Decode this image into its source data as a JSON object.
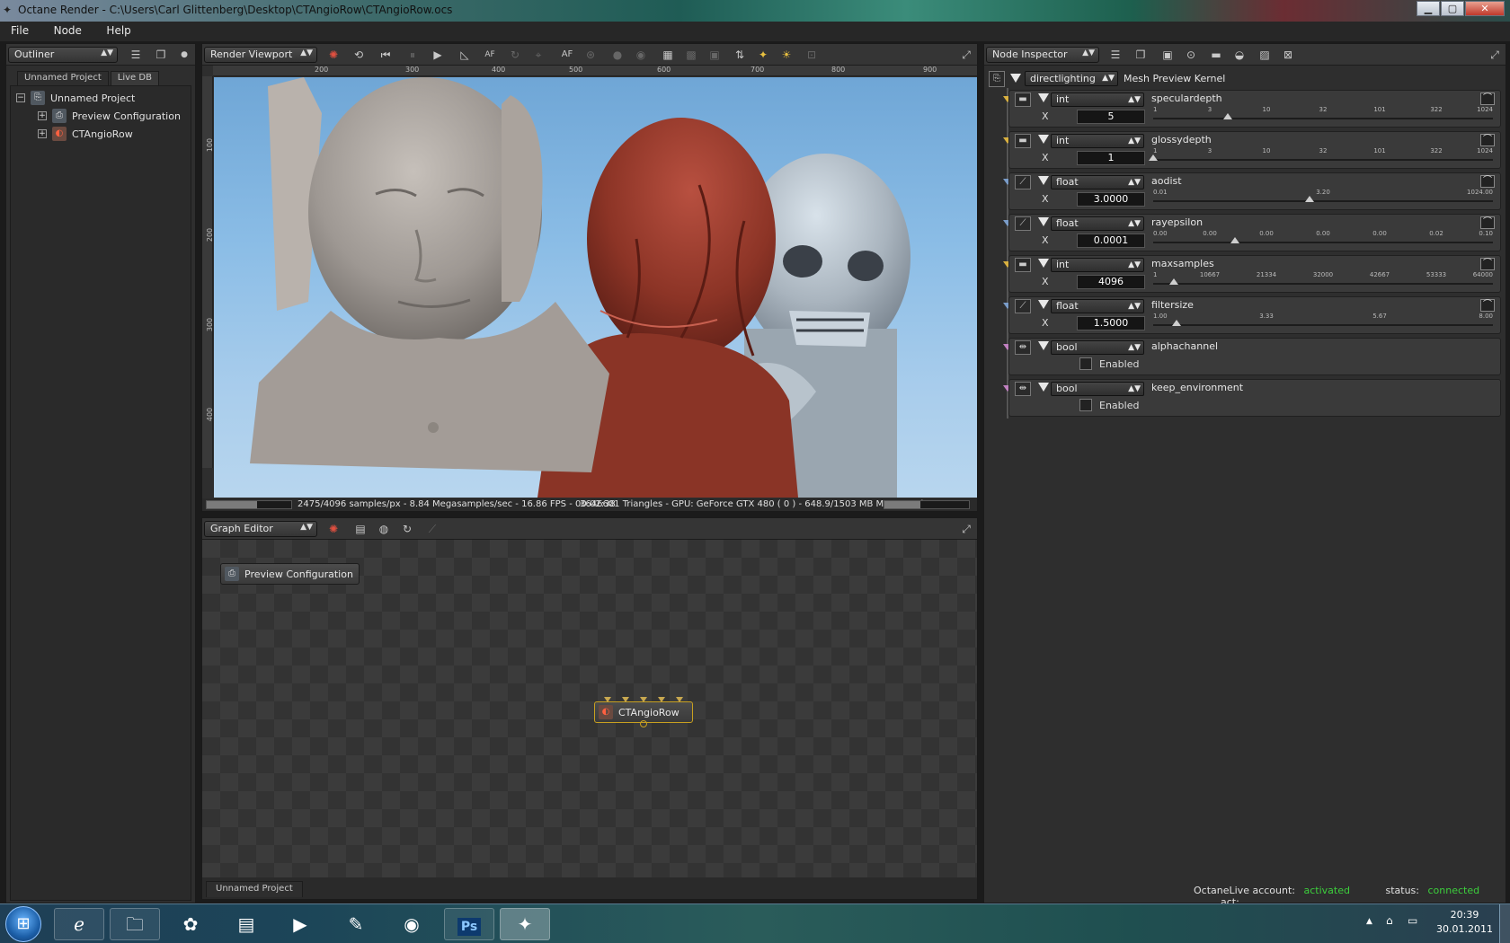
{
  "window": {
    "title": "Octane Render - C:\\Users\\Carl Glittenberg\\Desktop\\CTAngioRow\\CTAngioRow.ocs",
    "buttons": [
      "minimize",
      "maximize",
      "close"
    ]
  },
  "menubar": {
    "items": [
      "File",
      "Node",
      "Help"
    ]
  },
  "outliner": {
    "combo": "Outliner",
    "tabs": [
      "Unnamed Project",
      "Live DB"
    ],
    "tree": [
      {
        "label": "Unnamed Project",
        "expander": "−"
      },
      {
        "label": "Preview Configuration",
        "expander": "+"
      },
      {
        "label": "CTAngioRow",
        "expander": "+"
      }
    ]
  },
  "viewport": {
    "combo": "Render Viewport",
    "ruler_h": [
      "200",
      "300",
      "400",
      "500",
      "600",
      "700",
      "800",
      "900"
    ],
    "ruler_v": [
      "100",
      "200",
      "300",
      "400"
    ],
    "status_left": "2475/4096 samples/px - 8.84 Megasamples/sec - 16.86 FPS - 00:02:38",
    "status_right": "3646601 Triangles - GPU: GeForce GTX 480 ( 0 ) - 648.9/1503 MB Mem Used",
    "progress_fraction": 0.6,
    "mem_fraction": 0.43
  },
  "graph_editor": {
    "combo": "Graph Editor",
    "nodes": [
      "Preview Configuration",
      "CTAngioRow"
    ],
    "tab": "Unnamed Project"
  },
  "inspector": {
    "combo": "Node Inspector",
    "kernel_combo": "directlighting",
    "kernel_label": "Mesh Preview Kernel",
    "params": [
      {
        "type": "int",
        "name": "speculardepth",
        "value": "5",
        "ticks": [
          "1",
          "3",
          "10",
          "32",
          "101",
          "322",
          "1024"
        ],
        "fraction": 0.22
      },
      {
        "type": "int",
        "name": "glossydepth",
        "value": "1",
        "ticks": [
          "1",
          "3",
          "10",
          "32",
          "101",
          "322",
          "1024"
        ],
        "fraction": 0.0
      },
      {
        "type": "float",
        "name": "aodist",
        "value": "3.0000",
        "ticks": [
          "0.01",
          "3.20",
          "1024.00"
        ],
        "fraction": 0.46
      },
      {
        "type": "float",
        "name": "rayepsilon",
        "value": "0.0001",
        "ticks": [
          "0.00",
          "0.00",
          "0.00",
          "0.00",
          "0.00",
          "0.02",
          "0.10"
        ],
        "fraction": 0.24
      },
      {
        "type": "int",
        "name": "maxsamples",
        "value": "4096",
        "ticks": [
          "1",
          "10667",
          "21334",
          "32000",
          "42667",
          "53333",
          "64000"
        ],
        "fraction": 0.06
      },
      {
        "type": "float",
        "name": "filtersize",
        "value": "1.5000",
        "ticks": [
          "1.00",
          "3.33",
          "5.67",
          "8.00"
        ],
        "fraction": 0.07
      },
      {
        "type": "bool",
        "name": "alphachannel",
        "check_label": "Enabled"
      },
      {
        "type": "bool",
        "name": "keep_environment",
        "check_label": "Enabled"
      }
    ],
    "x_label": "X"
  },
  "live_status": {
    "account_label": "OctaneLive account:",
    "account_value": "activated",
    "status_label": "status:",
    "status_value": "connected",
    "act_label": "act:"
  },
  "taskbar": {
    "apps": [
      "internet-explorer",
      "file-explorer",
      "picasa",
      "notepad",
      "media-player",
      "app",
      "browser",
      "photoshop",
      "octane"
    ],
    "time": "20:39",
    "date": "30.01.2011"
  },
  "colors": {
    "status_green": "#3ccf3c",
    "accent_gold": "#c8a020"
  }
}
